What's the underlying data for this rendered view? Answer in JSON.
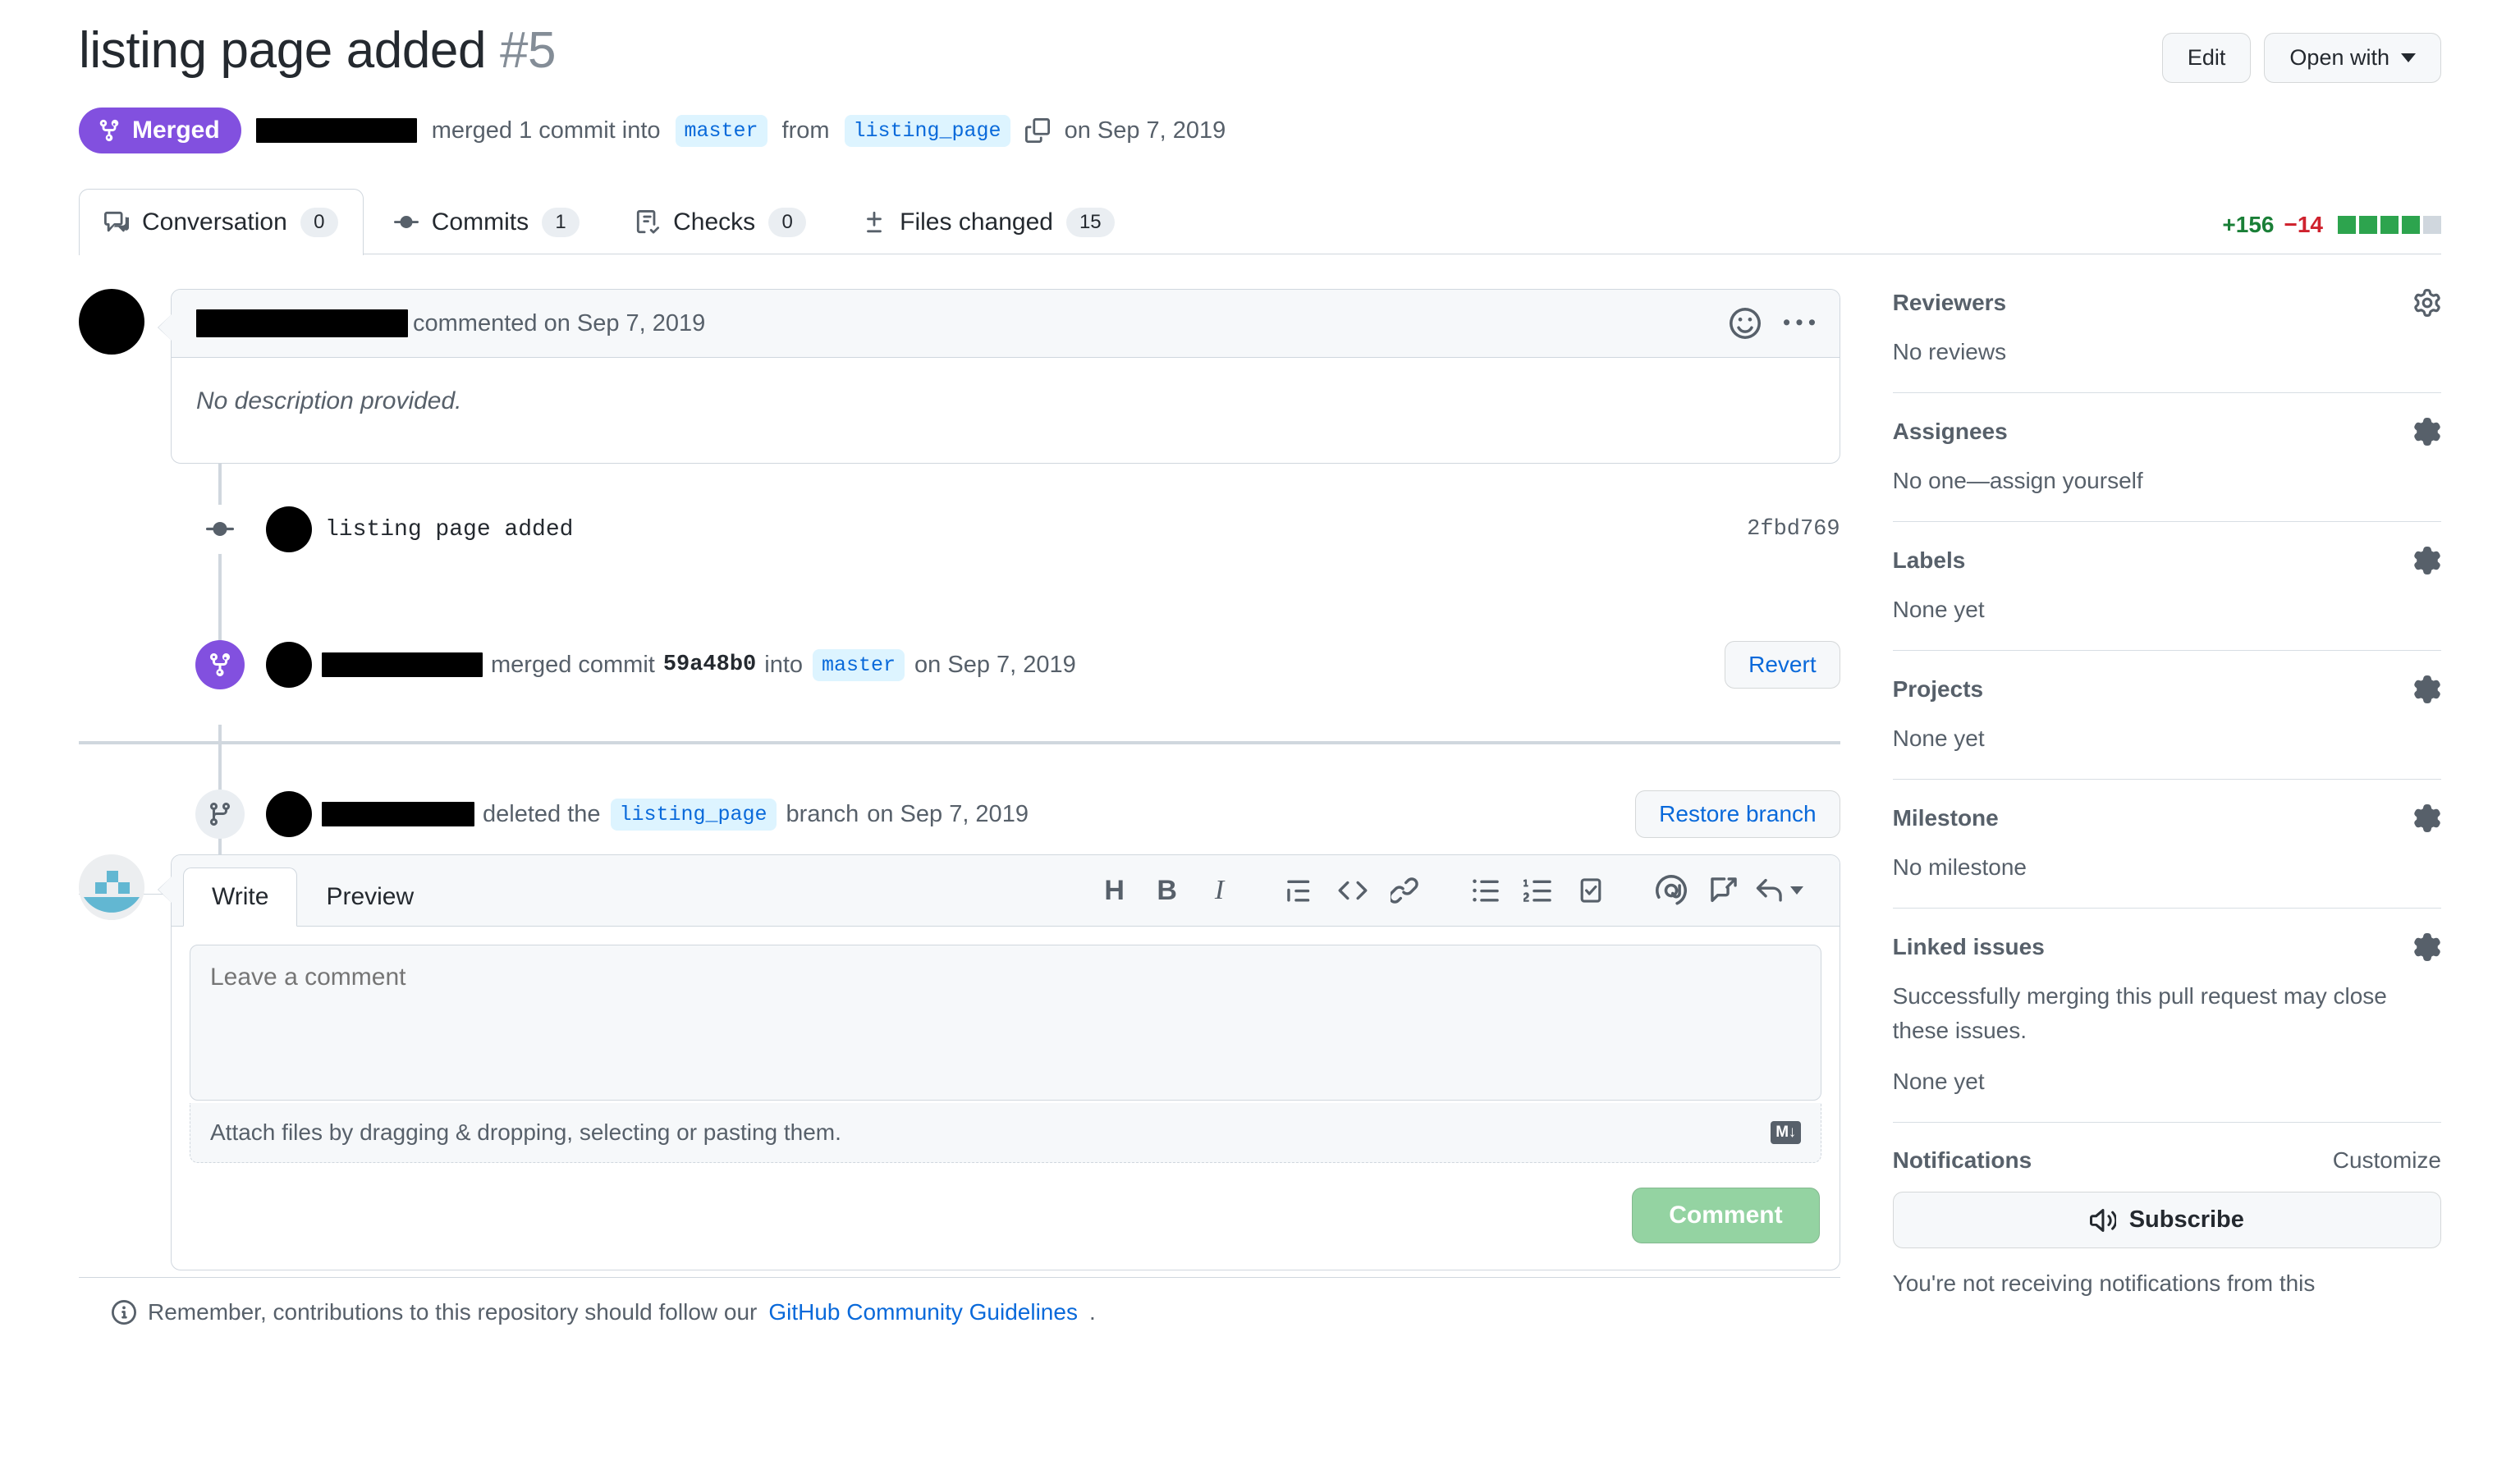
{
  "header": {
    "title": "listing page added",
    "number": "#5",
    "actions": {
      "edit": "Edit",
      "open_with": "Open with"
    },
    "state": {
      "badge": "Merged",
      "author_redacted": true,
      "action_text": "merged 1 commit into",
      "base_branch": "master",
      "from_text": "from",
      "head_branch": "listing_page",
      "date": "on Sep 7, 2019"
    }
  },
  "tabs": [
    {
      "label": "Conversation",
      "count": "0",
      "icon": "comment-discussion-icon",
      "active": true
    },
    {
      "label": "Commits",
      "count": "1",
      "icon": "git-commit-icon",
      "active": false
    },
    {
      "label": "Checks",
      "count": "0",
      "icon": "checklist-icon",
      "active": false
    },
    {
      "label": "Files changed",
      "count": "15",
      "icon": "diff-icon",
      "active": false
    }
  ],
  "diffstat": {
    "added": "+156",
    "deleted": "−14",
    "blocks_on": 4,
    "blocks_total": 5,
    "added_color": "#1a7f37",
    "deleted_color": "#cf222e",
    "block_on_color": "#2da44e",
    "block_off_color": "#d0d7de"
  },
  "conversation": {
    "comment": {
      "author_redacted": true,
      "meta": "commented on Sep 7, 2019",
      "body": "No description provided."
    },
    "timeline": [
      {
        "type": "commit",
        "icon": "git-commit-icon",
        "message": "listing page added",
        "sha": "2fbd769"
      },
      {
        "type": "merged",
        "icon": "git-merge-icon",
        "text_before": "merged commit",
        "sha": "59a48b0",
        "text_mid": "into",
        "branch": "master",
        "date": "on Sep 7, 2019",
        "button": "Revert"
      },
      {
        "type": "branch-deleted",
        "icon": "git-branch-icon",
        "text_before": "deleted the",
        "branch": "listing_page",
        "text_mid": "branch",
        "date": "on Sep 7, 2019",
        "button": "Restore branch"
      }
    ]
  },
  "comment_form": {
    "tabs": [
      {
        "label": "Write",
        "active": true
      },
      {
        "label": "Preview",
        "active": false
      }
    ],
    "toolbar": [
      {
        "name": "heading-icon",
        "glyph": "H"
      },
      {
        "name": "bold-icon",
        "glyph": "B"
      },
      {
        "name": "italic-icon",
        "glyph": "I"
      },
      {
        "name": "quote-icon",
        "glyph": ""
      },
      {
        "name": "code-icon",
        "glyph": ""
      },
      {
        "name": "link-icon",
        "glyph": ""
      },
      {
        "name": "unordered-list-icon",
        "glyph": ""
      },
      {
        "name": "ordered-list-icon",
        "glyph": ""
      },
      {
        "name": "task-list-icon",
        "glyph": ""
      },
      {
        "name": "mention-icon",
        "glyph": "@"
      },
      {
        "name": "cross-reference-icon",
        "glyph": ""
      },
      {
        "name": "saved-reply-icon",
        "glyph": ""
      }
    ],
    "textarea_placeholder": "Leave a comment",
    "attach_text": "Attach files by dragging & dropping, selecting or pasting them.",
    "markdown_badge": "M↓",
    "submit_label": "Comment",
    "guidelines_prefix": "Remember, contributions to this repository should follow our",
    "guidelines_link": "GitHub Community Guidelines",
    "guidelines_suffix": "."
  },
  "sidebar": {
    "sections": [
      {
        "title": "Reviewers",
        "gear": "gear-icon",
        "body": "No reviews"
      },
      {
        "title": "Assignees",
        "gear": "gear-icon",
        "body": "No one—assign yourself"
      },
      {
        "title": "Labels",
        "gear": "gear-icon",
        "body": "None yet"
      },
      {
        "title": "Projects",
        "gear": "gear-icon",
        "body": "None yet"
      },
      {
        "title": "Milestone",
        "gear": "gear-icon",
        "body": "No milestone"
      },
      {
        "title": "Linked issues",
        "gear": "gear-icon",
        "body": "Successfully merging this pull request may close these issues.",
        "body2": "None yet"
      }
    ],
    "notifications": {
      "title": "Notifications",
      "customize": "Customize",
      "subscribe": "Subscribe",
      "status": "You're not receiving notifications from this"
    }
  }
}
